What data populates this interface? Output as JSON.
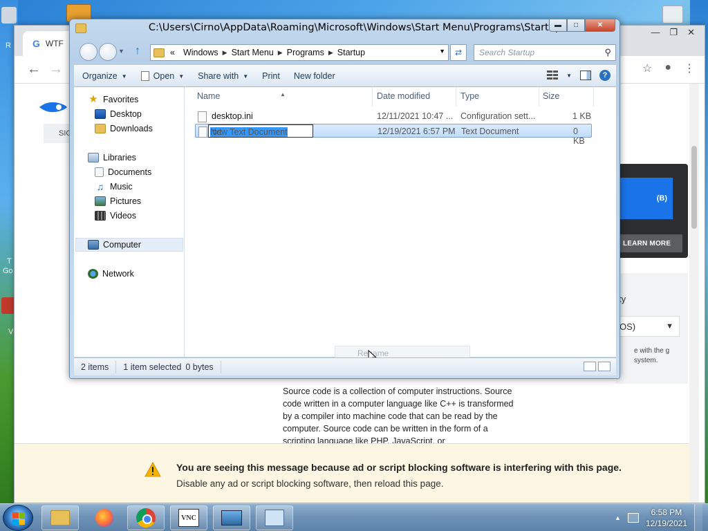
{
  "desktop": {
    "left_labels": [
      "R",
      "T",
      "Go",
      "V"
    ]
  },
  "chrome": {
    "tab_title": "WTF",
    "google_letter": "G",
    "sign_in": "SIG",
    "promo_text": "(B)",
    "learn_more": "LEARN MORE",
    "side_label": "ty",
    "side_select": "OS)",
    "side_note": "e with the g system.",
    "article": "Source code is a collection of computer instructions. Source code written in a computer language like C++ is transformed by a compiler into machine code that can be read by the computer. Source code can be written in the form of a scripting language like PHP, JavaScript, or",
    "adblock_title": "You are seeing this message because ad or script blocking software is interfering with this page.",
    "adblock_sub": "Disable any ad or script blocking software, then reload this page."
  },
  "explorer": {
    "title": "C:\\Users\\Cirno\\AppData\\Roaming\\Microsoft\\Windows\\Start Menu\\Programs\\Startup",
    "address": {
      "prefix": "«",
      "segments": [
        "Windows",
        "Start Menu",
        "Programs",
        "Startup"
      ]
    },
    "search_placeholder": "Search Startup",
    "commands": [
      "Organize",
      "Open",
      "Share with",
      "Print",
      "New folder"
    ],
    "nav": {
      "favorites": "Favorites",
      "desktop": "Desktop",
      "downloads": "Downloads",
      "libraries": "Libraries",
      "documents": "Documents",
      "music": "Music",
      "pictures": "Pictures",
      "videos": "Videos",
      "computer": "Computer",
      "network": "Network"
    },
    "columns": {
      "name": "Name",
      "date": "Date modified",
      "type": "Type",
      "size": "Size"
    },
    "files": [
      {
        "name": "desktop.ini",
        "date": "12/11/2021 10:47 ...",
        "type": "Configuration sett...",
        "size": "1 KB"
      },
      {
        "name": "New Text Document.txt",
        "date": "12/19/2021 6:57 PM",
        "type": "Text Document",
        "size": "0 KB"
      }
    ],
    "rename": {
      "selected_part": "New Text Document",
      "rest": ".txt"
    },
    "tooltip": "Rename",
    "status": {
      "items": "2 items",
      "selected": "1 item selected",
      "bytes": "0 bytes"
    }
  },
  "taskbar": {
    "vnc_label": "VNC",
    "time": "6:58 PM",
    "date": "12/19/2021"
  }
}
